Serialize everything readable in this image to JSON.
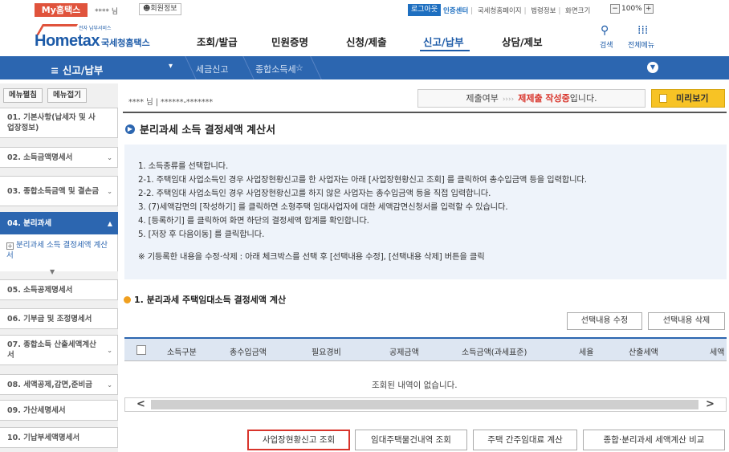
{
  "topbar": {
    "my_hometax": "My홈택스",
    "user_name": "**** 님",
    "user_info": "회원정보",
    "logout": "로그아웃",
    "links": [
      "인증센터",
      "국세청홈페이지",
      "법령정보"
    ],
    "zoom_label": "화면크기",
    "zoom_minus": "−",
    "zoom_value": "100%",
    "zoom_plus": "+"
  },
  "logo": {
    "text": "Hometax",
    "sub": "국세청홈택스",
    "tiny": "전자 납부서비스"
  },
  "nav": [
    "조회/발급",
    "민원증명",
    "신청/제출",
    "신고/납부",
    "상담/제보"
  ],
  "utility": {
    "search": "검색",
    "all_menu": "전체메뉴"
  },
  "bluebar": {
    "menu": "신고/납부",
    "crumbs": [
      "세금신고",
      "종합소득세"
    ]
  },
  "sidebar": {
    "edit": "메뉴펼침",
    "collapse": "메뉴접기",
    "items": [
      "01. 기본사항(납세자 및 사업장정보)",
      "02. 소득금액명세서",
      "03. 종합소득금액 및 결손금",
      "04. 분리과세",
      "05. 소득공제명세서",
      "06. 기부금 및 조정명세서",
      "07. 종합소득 산출세액계산서",
      "08. 세액공제,감면,준비금",
      "09. 가산세명세서",
      "10. 기납부세액명세서"
    ],
    "sub_item": "분리과세 소득 결정세액 계산서"
  },
  "main": {
    "user_line": "**** 님 | ******-*******",
    "submit_status_label": "제출여부",
    "submit_status_arrows": "››››",
    "submit_status_value": "제제출 작성중",
    "submit_status_suffix": "입니다.",
    "preview": "미리보기",
    "title": "분리과세 소득 결정세액 계산서",
    "guide": [
      "1. 소득종류를 선택합니다.",
      "2-1. 주택임대 사업소득인 경우 사업장현황신고를 한 사업자는 아래 [사업장현황신고 조회] 를 클릭하여 총수입금액 등을 입력합니다.",
      "2-2. 주택임대 사업소득인 경우 사업장현황신고를 하지 않은 사업자는 총수입금액 등을 직접 입력합니다.",
      "3. (7)세액감면의 [작성하기] 를 클릭하면 소형주택 임대사업자에 대한 세액감면신청서를 입력할 수 있습니다.",
      "4. [등록하기] 를 클릭하여 화면 하단의 결정세액 합계를 확인합니다.",
      "5. [저장 후 다음이동] 를 클릭합니다.",
      "※ 기등록한 내용을 수정·삭제 : 아래 체크박스를 선택 후 [선택내용 수정], [선택내용 삭제] 버튼을 클릭"
    ],
    "section_title": "1. 분리과세 주택임대소득 결정세액 계산",
    "edit_selected": "선택내용 수정",
    "delete_selected": "선택내용 삭제",
    "columns": [
      "소득구분",
      "총수입금액",
      "필요경비",
      "공제금액",
      "소득금액(과세표준)",
      "세율",
      "산출세액",
      "세액"
    ],
    "empty_message": "조회된 내역이 없습니다.",
    "buttons": [
      "사업장현황신고 조회",
      "임대주택물건내역 조회",
      "주택 간주임대료 계산",
      "종합·분리과세 세액계산 비교"
    ]
  },
  "colors": {
    "brand_blue": "#2c66b0",
    "accent_red": "#d8342b",
    "preview_yellow": "#f7c325"
  }
}
